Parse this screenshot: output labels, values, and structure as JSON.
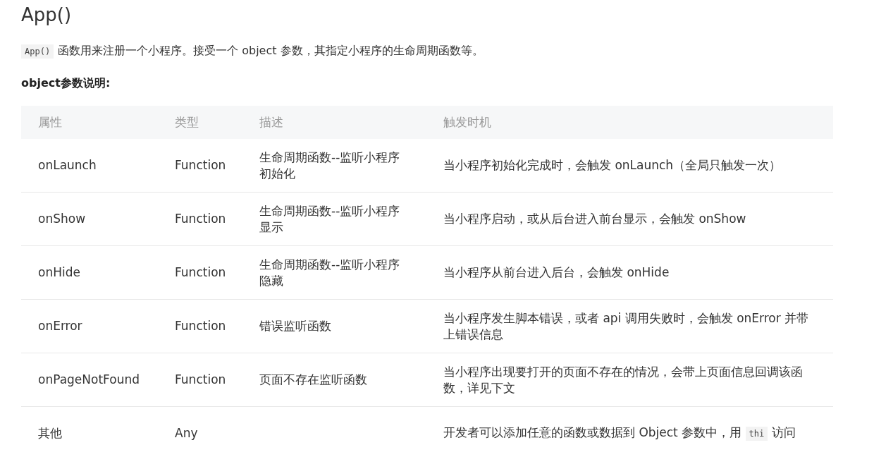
{
  "title": "App()",
  "intro": [
    {
      "kind": "code",
      "text": "App()"
    },
    {
      "kind": "text",
      "text": "函数用来注册一个小程序。接受一个 object 参数，其指定小程序的生命周期函数等。"
    }
  ],
  "subheading": "object参数说明:",
  "table": {
    "columns": [
      "属性",
      "类型",
      "描述",
      "触发时机"
    ],
    "rows": [
      {
        "cells": [
          [
            {
              "kind": "text",
              "text": "onLaunch"
            }
          ],
          [
            {
              "kind": "text",
              "text": "Function"
            }
          ],
          [
            {
              "kind": "text",
              "text": "生命周期函数--监听小程序初始化"
            }
          ],
          [
            {
              "kind": "text",
              "text": "当小程序初始化完成时，会触发 onLaunch（全局只触发一次）"
            }
          ]
        ]
      },
      {
        "cells": [
          [
            {
              "kind": "text",
              "text": "onShow"
            }
          ],
          [
            {
              "kind": "text",
              "text": "Function"
            }
          ],
          [
            {
              "kind": "text",
              "text": "生命周期函数--监听小程序显示"
            }
          ],
          [
            {
              "kind": "text",
              "text": "当小程序启动，或从后台进入前台显示，会触发 onShow"
            }
          ]
        ]
      },
      {
        "cells": [
          [
            {
              "kind": "text",
              "text": "onHide"
            }
          ],
          [
            {
              "kind": "text",
              "text": "Function"
            }
          ],
          [
            {
              "kind": "text",
              "text": "生命周期函数--监听小程序隐藏"
            }
          ],
          [
            {
              "kind": "text",
              "text": "当小程序从前台进入后台，会触发 onHide"
            }
          ]
        ]
      },
      {
        "cells": [
          [
            {
              "kind": "text",
              "text": "onError"
            }
          ],
          [
            {
              "kind": "text",
              "text": "Function"
            }
          ],
          [
            {
              "kind": "text",
              "text": "错误监听函数"
            }
          ],
          [
            {
              "kind": "text",
              "text": "当小程序发生脚本错误，或者 api 调用失败时，会触发 onError 并带上错误信息"
            }
          ]
        ]
      },
      {
        "cells": [
          [
            {
              "kind": "text",
              "text": "onPageNotFound"
            }
          ],
          [
            {
              "kind": "text",
              "text": "Function"
            }
          ],
          [
            {
              "kind": "text",
              "text": "页面不存在监听函数"
            }
          ],
          [
            {
              "kind": "text",
              "text": "当小程序出现要打开的页面不存在的情况，会带上页面信息回调该函数，详见下文"
            }
          ]
        ]
      },
      {
        "cells": [
          [
            {
              "kind": "text",
              "text": "其他"
            }
          ],
          [
            {
              "kind": "text",
              "text": "Any"
            }
          ],
          [],
          [
            {
              "kind": "text",
              "text": "开发者可以添加任意的函数或数据到 Object 参数中，用 "
            },
            {
              "kind": "code",
              "text": "thi"
            },
            {
              "kind": "text",
              "text": "访问"
            }
          ]
        ]
      }
    ]
  }
}
